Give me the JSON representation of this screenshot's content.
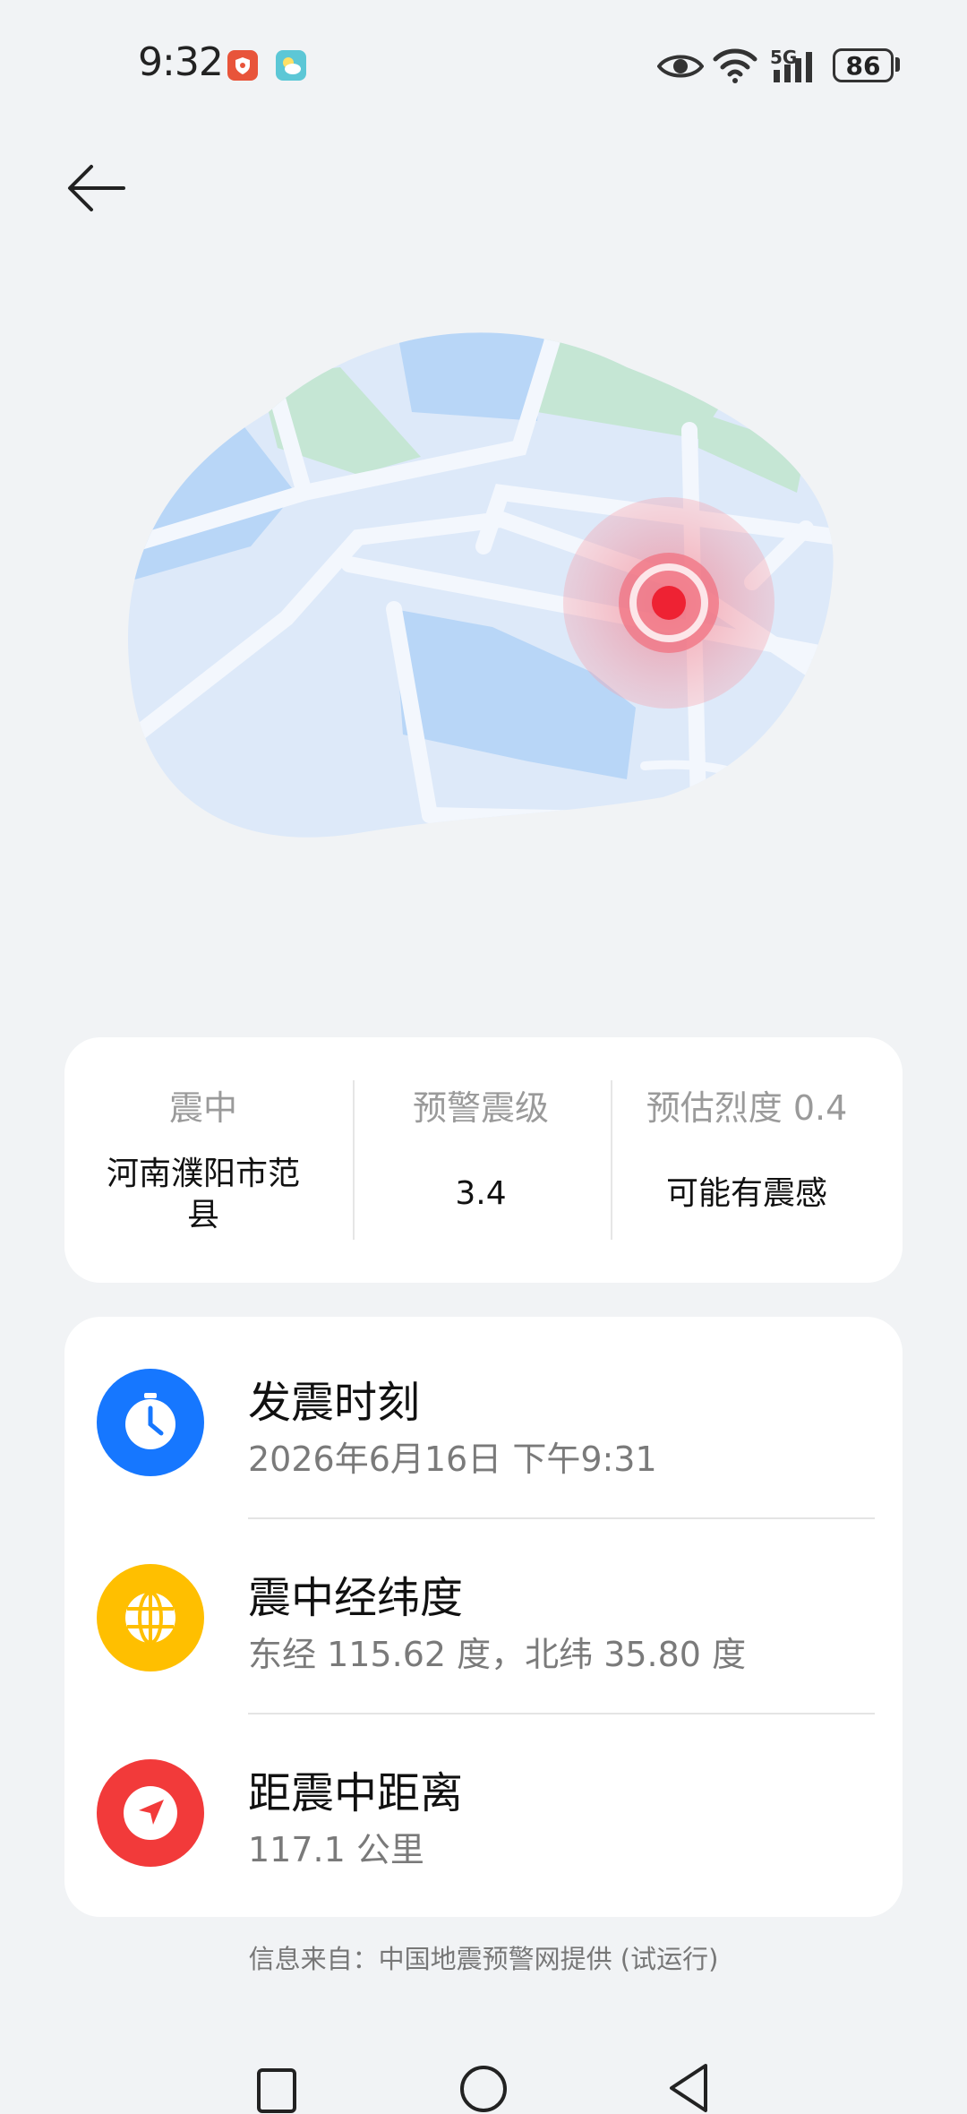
{
  "status_bar": {
    "time": "9:32",
    "network": "5G",
    "battery": "86",
    "icons": [
      "security-badge-icon",
      "weather-badge-icon",
      "eye-icon",
      "wifi-icon",
      "signal-icon",
      "battery-icon"
    ]
  },
  "header": {
    "back_icon": "arrow-left-icon"
  },
  "summary": {
    "epicenter_label": "震中",
    "epicenter_value": "河南濮阳市范县",
    "magnitude_label": "预警震级",
    "magnitude_value": "3.4",
    "intensity_label": "预估烈度 0.4",
    "intensity_value": "可能有震感"
  },
  "details": [
    {
      "icon": "clock-icon",
      "color": "#1677ff",
      "title": "发震时刻",
      "value": "2026年6月16日 下午9:31"
    },
    {
      "icon": "globe-icon",
      "color": "#ffbf00",
      "title": "震中经纬度",
      "value": "东经 115.62 度，北纬 35.80 度"
    },
    {
      "icon": "navigation-arrow-icon",
      "color": "#f23a3a",
      "title": "距震中距离",
      "value": "117.1 公里"
    }
  ],
  "footer": {
    "source": "信息来自：中国地震预警网提供 (试运行)"
  },
  "nav": {
    "icons": [
      "recent-apps-icon",
      "home-icon",
      "back-triangle-icon"
    ]
  },
  "colors": {
    "background": "#f1f3f5",
    "map_land": "#dde9f9",
    "map_water": "#b8d6f7",
    "map_park": "#c5e6d4",
    "epicenter": "#ee2233"
  }
}
